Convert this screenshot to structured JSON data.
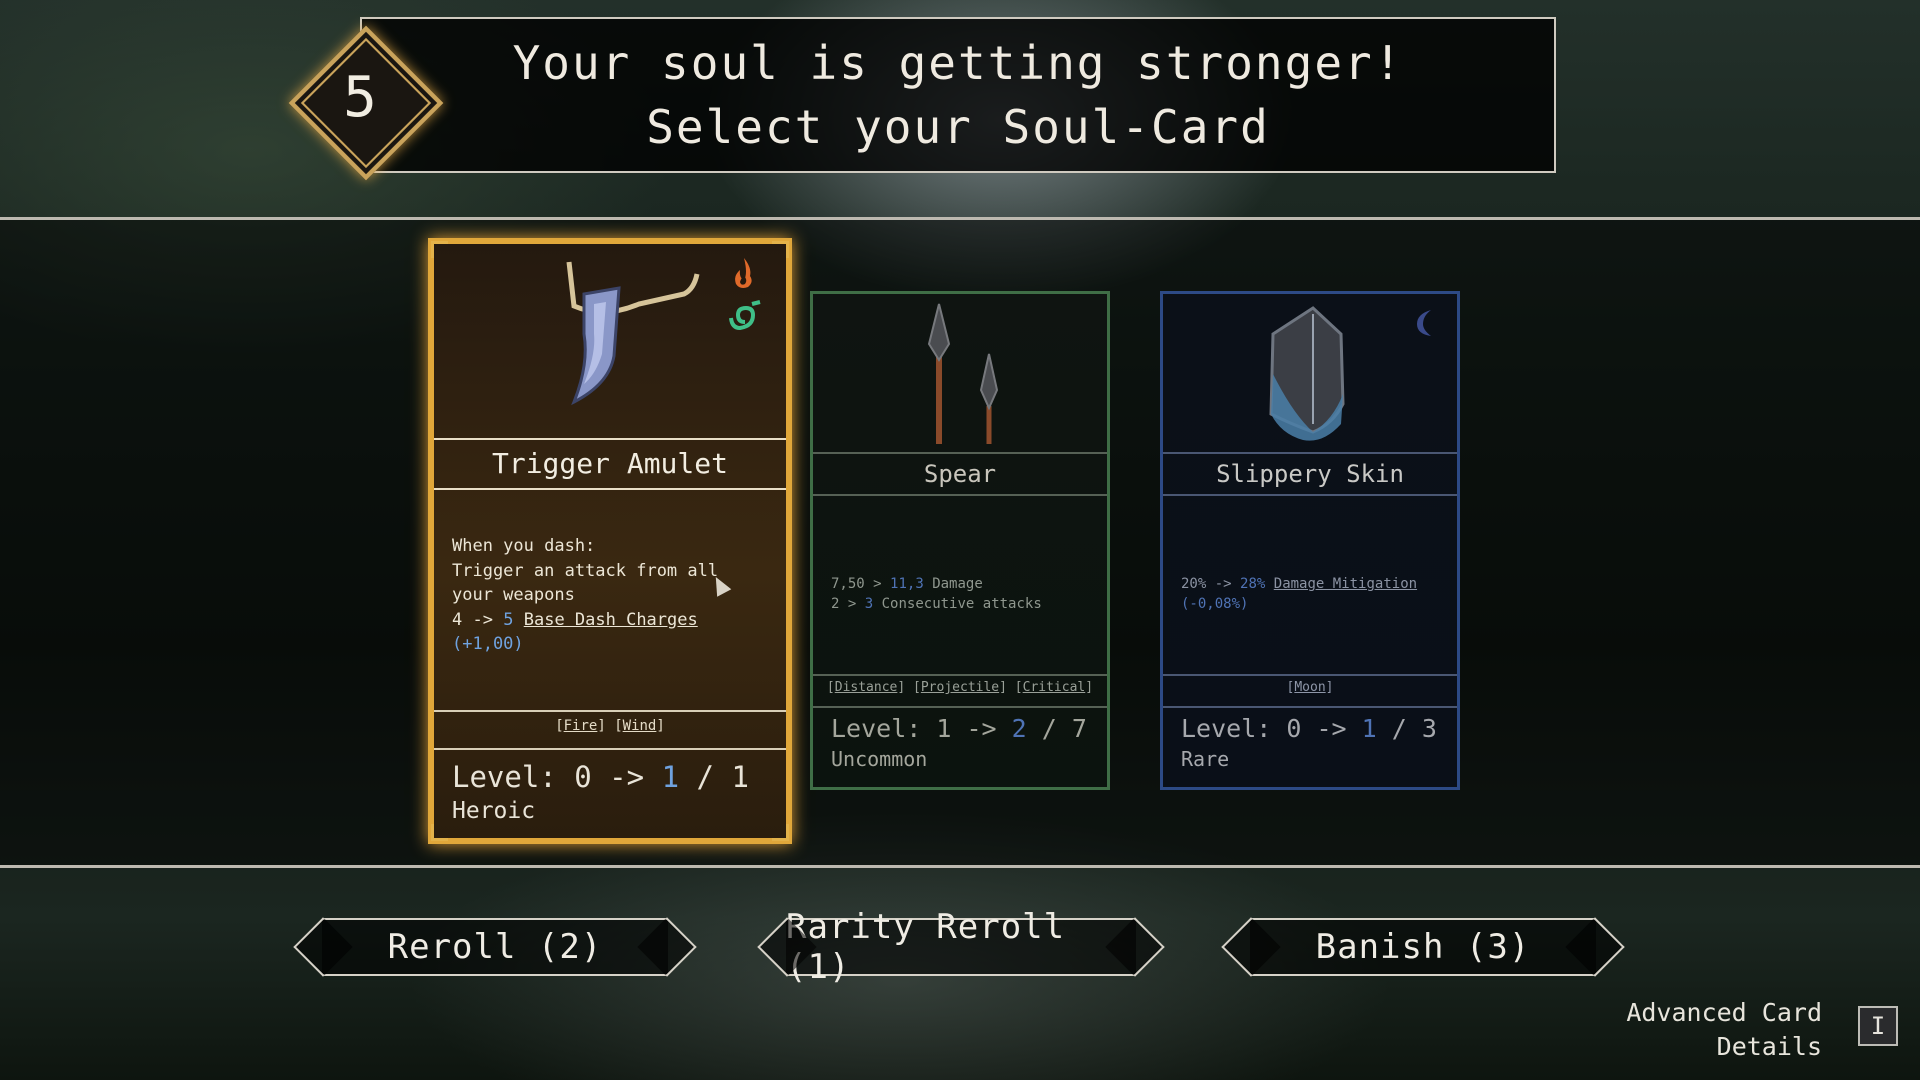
{
  "header": {
    "soul_level": "5",
    "title_line1": "Your soul is getting stronger!",
    "title_line2": "Select your Soul-Card"
  },
  "cards": [
    {
      "name": "Trigger Amulet",
      "rarity": "Heroic",
      "element_icons": [
        "fire-icon",
        "wind-icon"
      ],
      "desc_lines": [
        "When you dash:",
        "Trigger an attack from all",
        "your weapons"
      ],
      "stat1_from": "4",
      "stat1_arrow": "->",
      "stat1_to": "5",
      "stat1_label": "Base Dash Charges",
      "stat1_delta": "(+1,00)",
      "tags": [
        "Fire",
        "Wind"
      ],
      "level_label": "Level:",
      "level_from": "0",
      "level_arrow": "->",
      "level_to": "1",
      "level_sep": "/",
      "level_max": "1",
      "accent": "#e0a73a"
    },
    {
      "name": "Spear",
      "rarity": "Uncommon",
      "stat1_from": "7,50",
      "stat1_arrow": ">",
      "stat1_to": "11,3",
      "stat1_label": "Damage",
      "stat2_from": "2",
      "stat2_arrow": ">",
      "stat2_to": "3",
      "stat2_label": "Consecutive attacks",
      "tags": [
        "Distance",
        "Projectile",
        "Critical"
      ],
      "level_label": "Level:",
      "level_from": "1",
      "level_arrow": "->",
      "level_to": "2",
      "level_sep": "/",
      "level_max": "7",
      "accent": "#3f6e46"
    },
    {
      "name": "Slippery Skin",
      "rarity": "Rare",
      "element_icons": [
        "moon-icon"
      ],
      "stat1_from": "20%",
      "stat1_arrow": "->",
      "stat1_to": "28%",
      "stat1_label": "Damage Mitigation",
      "stat1_delta": "(-0,08%)",
      "tags": [
        "Moon"
      ],
      "level_label": "Level:",
      "level_from": "0",
      "level_arrow": "->",
      "level_to": "1",
      "level_sep": "/",
      "level_max": "3",
      "accent": "#2d4a86"
    }
  ],
  "buttons": {
    "reroll": "Reroll (2)",
    "rarity_reroll": "Rarity Reroll (1)",
    "banish": "Banish (3)"
  },
  "advanced": {
    "line1": "Advanced Card",
    "line2": "Details",
    "key": "I"
  }
}
